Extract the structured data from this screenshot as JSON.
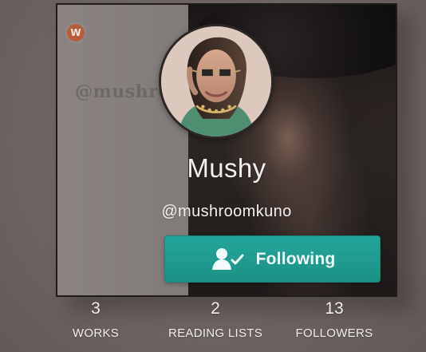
{
  "profile": {
    "logo_letter": "W",
    "background_handle": "@mushro",
    "display_name": "Mushy",
    "username": "@mushroomkuno",
    "follow_button_label": "Following"
  },
  "stats": [
    {
      "value": "3",
      "label": "WORKS"
    },
    {
      "value": "2",
      "label": "READING LISTS"
    },
    {
      "value": "13",
      "label": "FOLLOWERS"
    }
  ],
  "colors": {
    "accent": "#23a69b",
    "background": "#6f6663",
    "text": "#f3f0ef"
  },
  "icons": {
    "logo": "wattpad-logo-icon",
    "follow": "user-check-icon"
  }
}
